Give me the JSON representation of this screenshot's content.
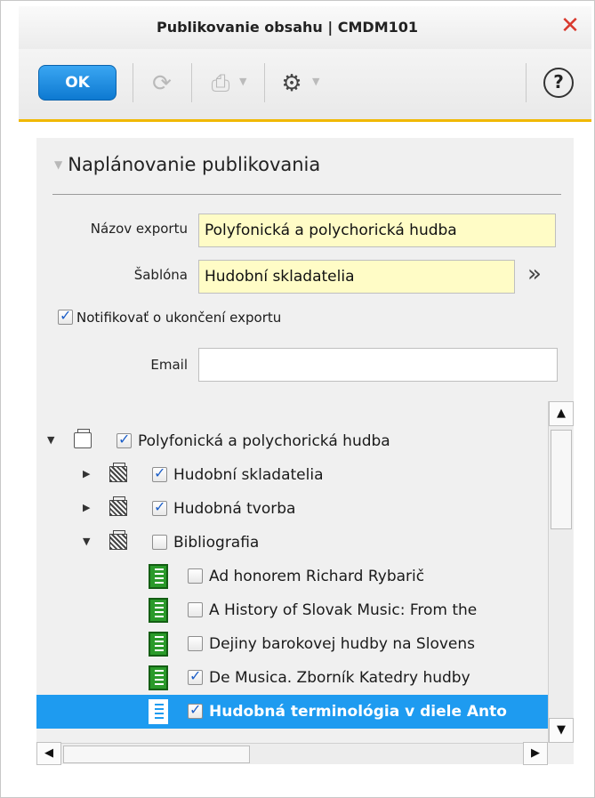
{
  "window": {
    "title": "Publikovanie obsahu | CMDM101"
  },
  "toolbar": {
    "ok_label": "OK",
    "help_label": "?",
    "icons": [
      "refresh-icon",
      "print-icon",
      "gear-icon",
      "help-icon"
    ]
  },
  "section": {
    "title": "Naplánovanie publikovania"
  },
  "form": {
    "export_name_label": "Názov exportu",
    "export_name_value": "Polyfonická a polychorická hudba",
    "template_label": "Šablóna",
    "template_value": "Hudobní skladatelia",
    "notify_label": "Notifikovať o ukončení exportu",
    "notify_checked": true,
    "email_label": "Email",
    "email_value": ""
  },
  "tree": {
    "rows": [
      {
        "label": "Polyfonická a polychorická hudba",
        "checked": true,
        "expanded": true,
        "icon": "folder-icon"
      },
      {
        "label": "Hudobní skladatelia",
        "checked": true,
        "expanded": false,
        "icon": "folder-icon"
      },
      {
        "label": "Hudobná tvorba",
        "checked": true,
        "expanded": false,
        "icon": "folder-icon"
      },
      {
        "label": "Bibliografia",
        "checked": false,
        "expanded": true,
        "icon": "folder-icon"
      },
      {
        "label": "Ad honorem Richard Rybarič",
        "checked": false,
        "icon": "book-icon"
      },
      {
        "label": "A History of Slovak Music: From the",
        "checked": false,
        "icon": "book-icon"
      },
      {
        "label": "Dejiny barokovej hudby na Slovens",
        "checked": false,
        "icon": "book-icon"
      },
      {
        "label": "De Musica. Zborník Katedry hudby",
        "checked": true,
        "icon": "book-icon"
      },
      {
        "label": "Hudobná terminológia v diele Anto",
        "checked": true,
        "selected": true,
        "icon": "book-icon"
      }
    ]
  },
  "colors": {
    "accent": "#1e9bf0",
    "toolbar_underline": "#f0b800",
    "field_bg": "#fffcc6",
    "close": "#d93a2f"
  }
}
